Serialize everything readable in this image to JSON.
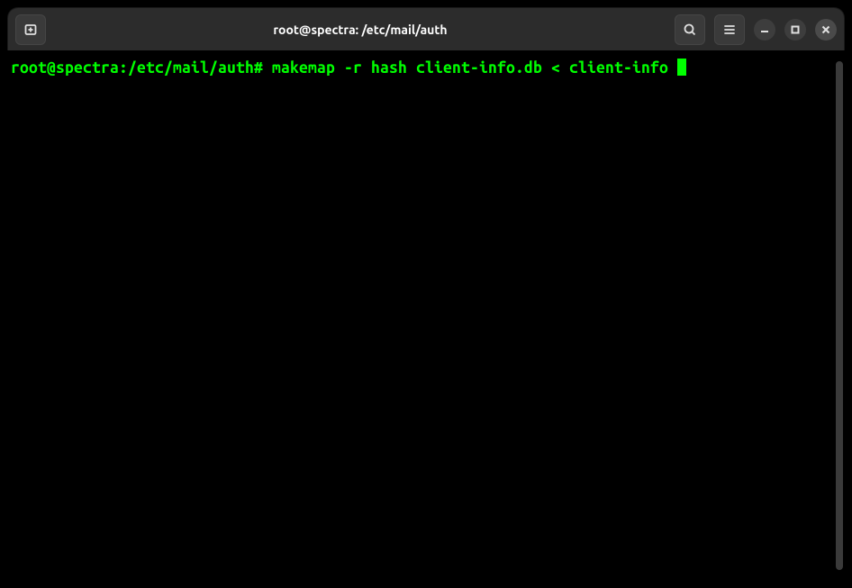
{
  "titlebar": {
    "title": "root@spectra: /etc/mail/auth"
  },
  "terminal": {
    "prompt": "root@spectra:/etc/mail/auth#",
    "command": "makemap -r hash client-info.db < client-info"
  }
}
